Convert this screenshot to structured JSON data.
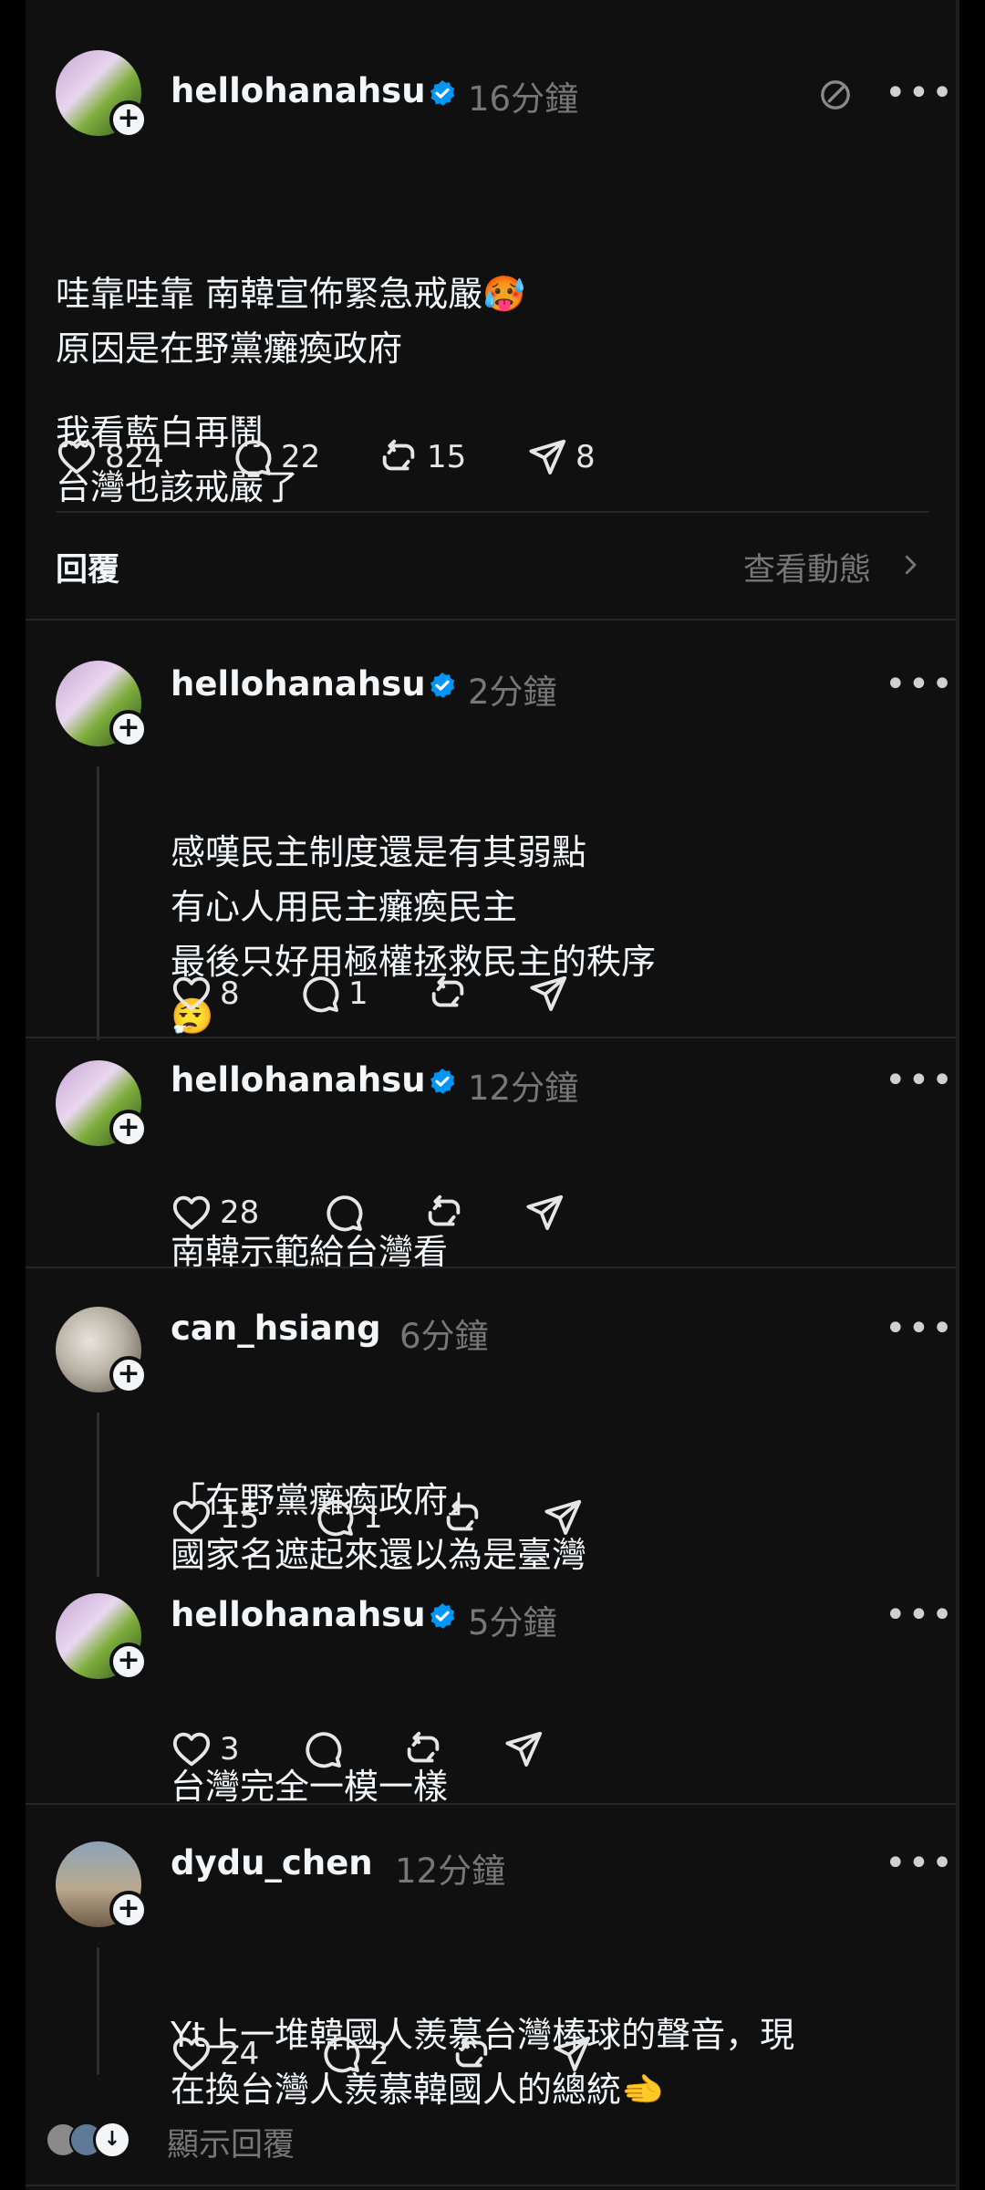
{
  "main_post": {
    "username": "hellohanahsu",
    "time": "16分鐘",
    "lines": [
      "哇靠哇靠 南韓宣佈緊急戒嚴🥵",
      "原因是在野黨癱瘓政府",
      "",
      "我看藍白再鬧",
      "台灣也該戒嚴了"
    ],
    "likes": "824",
    "comments": "22",
    "reposts": "15",
    "shares": "8"
  },
  "replies_bar": {
    "label": "回覆",
    "activity_link": "查看動態"
  },
  "replies": [
    {
      "username": "hellohanahsu",
      "time": "2分鐘",
      "verified": true,
      "lines": [
        "感嘆民主制度還是有其弱點",
        "有心人用民主癱瘓民主",
        "最後只好用極權拯救民主的秩序",
        "😮‍💨"
      ],
      "likes": "8",
      "comments": "1",
      "reposts": "",
      "shares": ""
    },
    {
      "username": "hellohanahsu",
      "time": "12分鐘",
      "verified": true,
      "lines": [
        "南韓示範給台灣看"
      ],
      "likes": "28",
      "comments": "",
      "reposts": "",
      "shares": ""
    },
    {
      "username": "can_hsiang",
      "time": "6分鐘",
      "verified": false,
      "lines": [
        "「在野黨癱瘓政府」",
        "國家名遮起來還以為是臺灣"
      ],
      "likes": "15",
      "comments": "1",
      "reposts": "",
      "shares": ""
    },
    {
      "username": "hellohanahsu",
      "time": "5分鐘",
      "verified": true,
      "lines": [
        "台灣完全一模一樣"
      ],
      "likes": "3",
      "comments": "",
      "reposts": "",
      "shares": ""
    },
    {
      "username": "dydu_chen",
      "time": "12分鐘",
      "verified": false,
      "lines": [
        "Yt上一堆韓國人羨慕台灣棒球的聲音，現",
        "在換台灣人羨慕韓國人的總統🫲"
      ],
      "likes": "24",
      "comments": "2",
      "reposts": "",
      "shares": ""
    }
  ],
  "show_replies": "顯示回覆",
  "colors": {
    "background": "#101010",
    "text": "#f3f5f7",
    "muted": "#777777",
    "verified": "#0095f6",
    "divider": "#262626"
  },
  "icons": [
    "heart-icon",
    "comment-icon",
    "repost-icon",
    "share-icon",
    "verified-icon",
    "more-icon",
    "follow-plus-icon",
    "translate-icon",
    "chevron-right-icon"
  ]
}
